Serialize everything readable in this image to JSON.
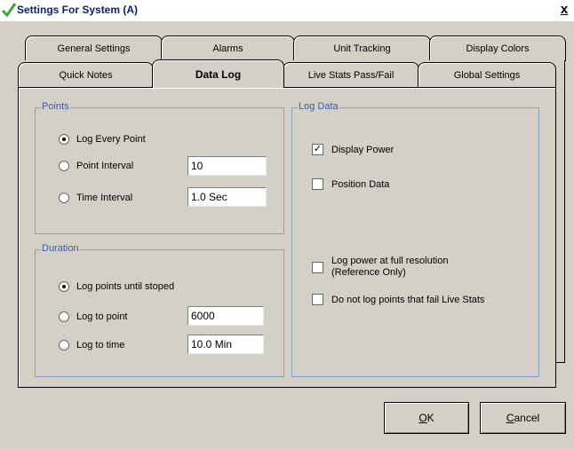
{
  "window": {
    "title": "Settings For System (A)",
    "close_label": "x"
  },
  "tabs": {
    "row1": [
      "General Settings",
      "Alarms",
      "Unit Tracking",
      "Display Colors"
    ],
    "row2": [
      "Quick Notes",
      "Data Log",
      "Live Stats Pass/Fail",
      "Global Settings"
    ],
    "active": "Data Log"
  },
  "points": {
    "label": "Points",
    "options": [
      {
        "label": "Log Every Point",
        "selected": true
      },
      {
        "label": "Point Interval",
        "selected": false,
        "value": "10"
      },
      {
        "label": "Time Interval",
        "selected": false,
        "value": "1.0 Sec"
      }
    ]
  },
  "duration": {
    "label": "Duration",
    "options": [
      {
        "label": "Log points until stoped",
        "selected": true
      },
      {
        "label": "Log to point",
        "selected": false,
        "value": "6000"
      },
      {
        "label": "Log to time",
        "selected": false,
        "value": "10.0 Min"
      }
    ]
  },
  "log_data": {
    "label": "Log Data",
    "items": [
      {
        "label": "Display Power",
        "checked": true
      },
      {
        "label": "Position Data",
        "checked": false
      },
      {
        "label_line1": "Log power at full resolution",
        "label_line2": "(Reference Only)",
        "checked": false
      },
      {
        "label": "Do not log points that fail Live Stats",
        "checked": false
      }
    ],
    "check_mark": "✓"
  },
  "buttons": {
    "ok": {
      "mnemonic": "O",
      "rest": "K"
    },
    "cancel": {
      "mnemonic": "C",
      "rest": "ancel"
    }
  }
}
